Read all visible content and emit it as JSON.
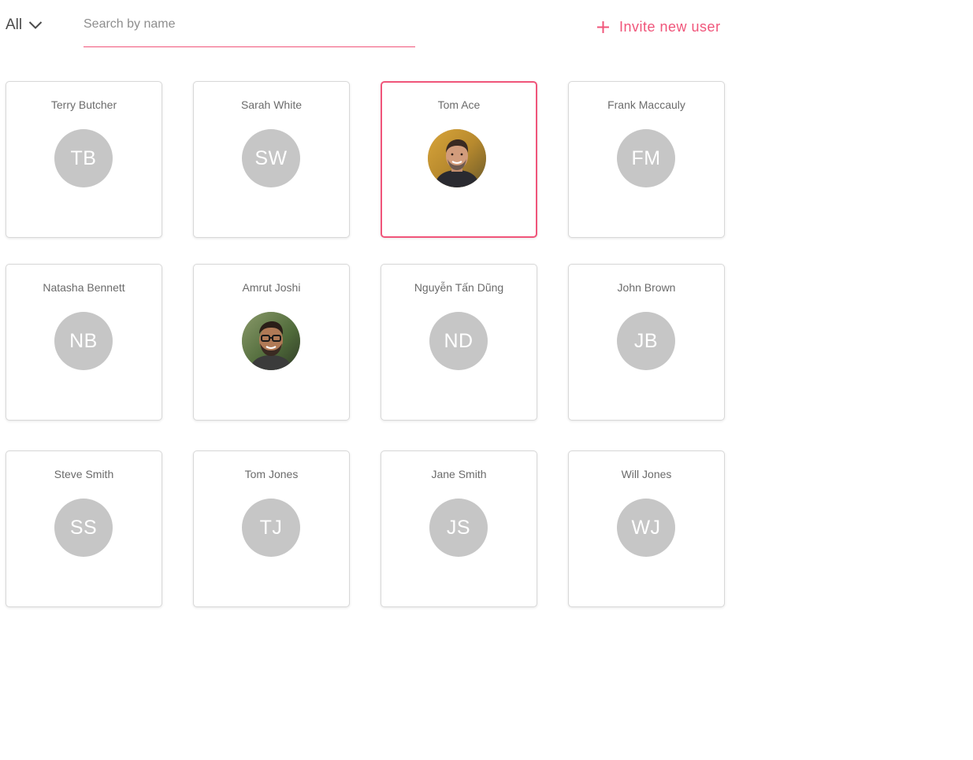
{
  "toolbar": {
    "filter_label": "All",
    "filter_icon": "chevron-down-icon",
    "search_placeholder": "Search by name",
    "search_value": "",
    "invite_label": "Invite new user",
    "invite_icon": "plus-icon"
  },
  "colors": {
    "accent": "#f0557a",
    "avatar_bg": "#c6c6c6",
    "card_border": "#d8d8d8"
  },
  "users": [
    {
      "name": "Terry Butcher",
      "initials": "TB",
      "photo": false
    },
    {
      "name": "Sarah White",
      "initials": "SW",
      "photo": false
    },
    {
      "name": "Tom Ace",
      "initials": "",
      "photo": true,
      "selected": true
    },
    {
      "name": "Frank Maccauly",
      "initials": "FM",
      "photo": false
    },
    {
      "name": "Natasha Bennett",
      "initials": "NB",
      "photo": false
    },
    {
      "name": "Amrut Joshi",
      "initials": "",
      "photo": true
    },
    {
      "name": "Nguyễn Tấn Dũng",
      "initials": "ND",
      "photo": false
    },
    {
      "name": "John Brown",
      "initials": "JB",
      "photo": false
    },
    {
      "name": "Steve Smith",
      "initials": "SS",
      "photo": false
    },
    {
      "name": "Tom Jones",
      "initials": "TJ",
      "photo": false
    },
    {
      "name": "Jane Smith",
      "initials": "JS",
      "photo": false
    },
    {
      "name": "Will Jones",
      "initials": "WJ",
      "photo": false
    }
  ]
}
